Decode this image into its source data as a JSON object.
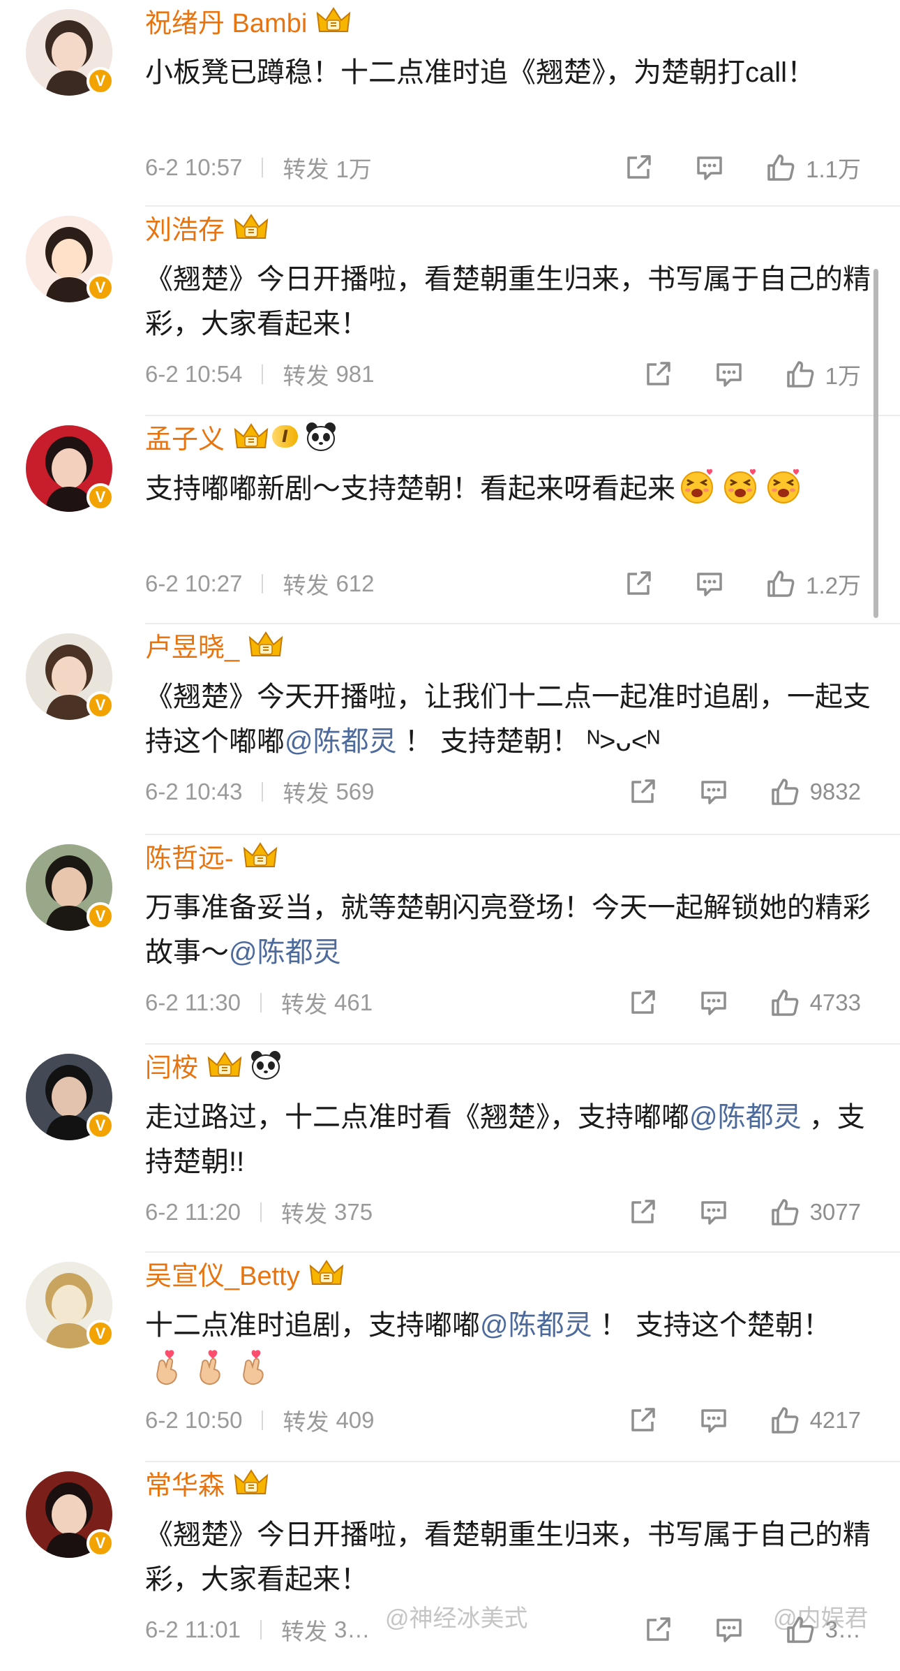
{
  "labels": {
    "repost": "转发"
  },
  "colors": {
    "username": "#e8740f",
    "mention": "#4d6a9c",
    "meta": "#9a9a9a",
    "verified": "#f2a300"
  },
  "watermarks": [
    "@神经冰美式",
    "@内娱君"
  ],
  "comments": [
    {
      "user": "祝绪丹 Bambi",
      "badges": [
        "crown-badge-icon"
      ],
      "segments": [
        {
          "t": "小板凳已蹲稳！十二点准时追《翘楚》，为楚朝打call！"
        }
      ],
      "time": "6-2 10:57",
      "reposts": "1万",
      "likes": "1.1万"
    },
    {
      "user": "刘浩存",
      "badges": [
        "crown-badge-icon"
      ],
      "segments": [
        {
          "t": "《翘楚》今日开播啦，看楚朝重生归来，书写属于自己的精彩，大家看起来！"
        }
      ],
      "time": "6-2 10:54",
      "reposts": "981",
      "likes": "1万"
    },
    {
      "user": "孟子义",
      "badges": [
        "crown-badge-icon",
        "level-badge",
        "panda-icon"
      ],
      "level": "I",
      "segments": [
        {
          "t": "支持嘟嘟新剧～支持楚朝！看起来呀看起来"
        },
        {
          "e": "excited-emoji-icon"
        },
        {
          "e": "excited-emoji-icon"
        },
        {
          "e": "excited-emoji-icon"
        }
      ],
      "time": "6-2 10:27",
      "reposts": "612",
      "likes": "1.2万"
    },
    {
      "user": "卢昱晓_",
      "badges": [
        "crown-badge-icon"
      ],
      "segments": [
        {
          "t": "《翘楚》今天开播啦，让我们十二点一起准时追剧，一起支持这个嘟嘟"
        },
        {
          "m": "@陈都灵"
        },
        {
          "t": " ！ 支持楚朝！ ᴺ>ᴗ<ᴺ"
        }
      ],
      "time": "6-2 10:43",
      "reposts": "569",
      "likes": "9832"
    },
    {
      "user": "陈哲远-",
      "badges": [
        "crown-badge-icon"
      ],
      "segments": [
        {
          "t": "万事准备妥当，就等楚朝闪亮登场！今天一起解锁她的精彩故事～"
        },
        {
          "m": "@陈都灵"
        }
      ],
      "time": "6-2 11:30",
      "reposts": "461",
      "likes": "4733"
    },
    {
      "user": "闫桉",
      "badges": [
        "crown-badge-icon",
        "panda-icon"
      ],
      "segments": [
        {
          "t": "走过路过，十二点准时看《翘楚》，支持嘟嘟"
        },
        {
          "m": "@陈都灵"
        },
        {
          "t": " ，支持楚朝!!"
        }
      ],
      "time": "6-2 11:20",
      "reposts": "375",
      "likes": "3077"
    },
    {
      "user": "吴宣仪_Betty",
      "badges": [
        "crown-badge-icon"
      ],
      "segments": [
        {
          "t": "十二点准时追剧，支持嘟嘟"
        },
        {
          "m": "@陈都灵"
        },
        {
          "t": " ！ 支持这个楚朝！"
        },
        {
          "e": "finger-heart-emoji-icon"
        },
        {
          "e": "finger-heart-emoji-icon"
        },
        {
          "e": "finger-heart-emoji-icon"
        }
      ],
      "time": "6-2 10:50",
      "reposts": "409",
      "likes": "4217"
    },
    {
      "user": "常华森",
      "badges": [
        "crown-badge-icon"
      ],
      "segments": [
        {
          "t": "《翘楚》今日开播啦，看楚朝重生归来，书写属于自己的精彩，大家看起来！"
        }
      ],
      "time": "6-2 11:01",
      "reposts": "3…",
      "likes": "3…"
    }
  ]
}
